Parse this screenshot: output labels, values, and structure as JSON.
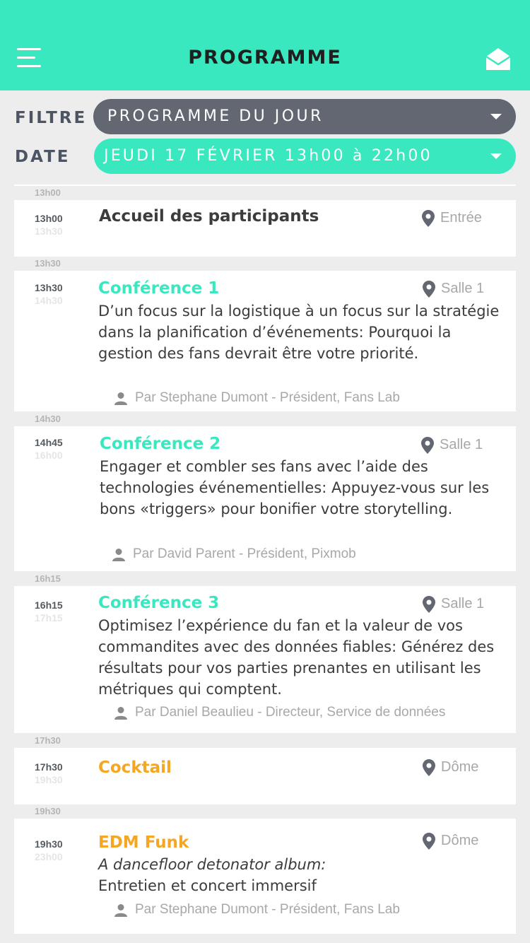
{
  "header": {
    "title": "PROGRAMME",
    "background": "#3ae8c0",
    "menu_icon": "hamburger-icon",
    "mail_icon": "open-envelope-icon"
  },
  "filters": {
    "filter_label": "FILTRE",
    "filter_value": "PROGRAMME DU JOUR",
    "date_label": "DATE",
    "date_value": "JEUDI 17 FÉVRIER 13h00 à 22h00"
  },
  "colors": {
    "accent": "#3ae8c0",
    "orange": "#f5a623",
    "filter_pill": "#636771"
  },
  "events": [
    {
      "slot": "13h00",
      "start": "13h00",
      "end": "13h30",
      "title": "Accueil des participants",
      "title_color": "dark",
      "location": "Entrée",
      "description": "",
      "speaker": ""
    },
    {
      "slot": "13h30",
      "start": "13h30",
      "end": "14h30",
      "title": "Conférence 1",
      "title_color": "teal",
      "location": "Salle 1",
      "description": "D’un focus sur la logistique à un focus sur la stratégie dans la planification d’événements: Pourquoi la gestion des fans devrait être votre priorité.",
      "speaker": "Par Stephane Dumont - Président, Fans Lab"
    },
    {
      "slot": "14h30",
      "start": "14h45",
      "end": "16h00",
      "title": "Conférence 2",
      "title_color": "teal",
      "location": "Salle 1",
      "description": "Engager et combler ses fans avec l’aide des technologies événementielles: Appuyez-vous sur les bons «triggers» pour bonifier votre storytelling.",
      "speaker": "Par David Parent - Président, Pixmob"
    },
    {
      "slot": "16h15",
      "start": "16h15",
      "end": "17h15",
      "title": "Conférence 3",
      "title_color": "teal",
      "location": "Salle 1",
      "description": "Optimisez l’expérience du fan et la valeur de vos commandites avec des données fiables: Générez des résultats pour vos parties prenantes en utilisant les métriques qui comptent.",
      "speaker": "Par Daniel Beaulieu - Directeur, Service de données"
    },
    {
      "slot": "17h30",
      "start": "17h30",
      "end": "19h30",
      "title": "Cocktail",
      "title_color": "orange",
      "location": "Dôme",
      "description": "",
      "speaker": ""
    },
    {
      "slot": "19h30",
      "start": "19h30",
      "end": "23h00",
      "title": "EDM Funk",
      "title_color": "orange",
      "location": "Dôme",
      "description_italic": "A dancefloor detonator album:",
      "description": "Entretien et concert immersif",
      "speaker": "Par Stephane Dumont - Président, Fans Lab"
    }
  ]
}
